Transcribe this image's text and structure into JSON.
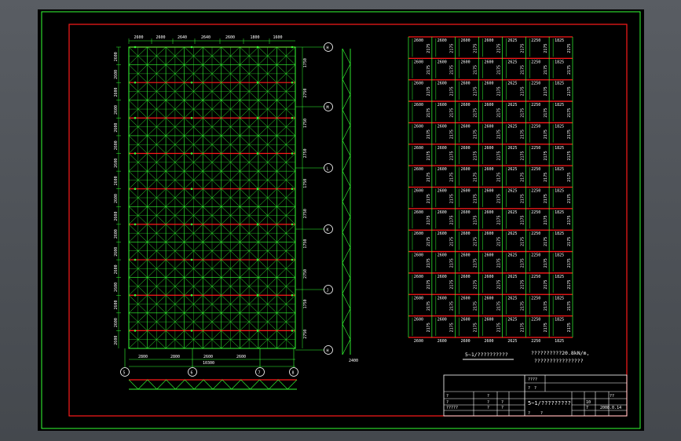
{
  "colors": {
    "background": "#000000",
    "frame": "#ff1a1a",
    "grid": "#33ff33",
    "text": "#ffffff",
    "viewport": "#4b4f55"
  },
  "plan": {
    "top_dims": [
      "2600",
      "2600",
      "2640",
      "2640",
      "2600",
      "1800",
      "1600"
    ],
    "left_dims": [
      "2600",
      "2600",
      "2600",
      "2600",
      "2600",
      "2600",
      "2600",
      "2600",
      "2600",
      "2600",
      "2600",
      "2600",
      "2600",
      "2600",
      "2600",
      "2600",
      "2600"
    ],
    "right_dims": [
      "1750",
      "2750",
      "1750",
      "2750",
      "1750",
      "2750",
      "1750",
      "2750",
      "1750",
      "2750"
    ],
    "bottom_dims": [
      "2800",
      "2800",
      "2600",
      "2600"
    ],
    "bottom_total": "10300",
    "side_dim": "2400",
    "axis_right": [
      "H",
      "M",
      "L",
      "K",
      "J",
      "H"
    ],
    "axis_bottom": [
      "5",
      "6",
      "7",
      "8"
    ]
  },
  "panel": {
    "col_labels": [
      "2600",
      "2600",
      "2600",
      "2600",
      "2625",
      "2250",
      "1825"
    ],
    "row_labels": [
      "2175",
      "2175",
      "2175",
      "2175",
      "2175",
      "2175",
      "2175",
      "2175",
      "2175",
      "2175",
      "2175",
      "2175",
      "2175",
      "2175"
    ]
  },
  "notes": {
    "plan_caption": "5~1/??????????",
    "load_note_1": "??????????20.8kN/m,",
    "load_note_2": "????????????????"
  },
  "titleblock": {
    "project": "????",
    "drawing_title": "5~1/?????????",
    "date": "2008.0.14",
    "scale": "10",
    "sheet": "7",
    "cells": [
      "?",
      "?",
      "?",
      "?",
      "??",
      "?",
      "?",
      "?",
      "?????",
      "?",
      "?",
      "?",
      "?"
    ]
  }
}
